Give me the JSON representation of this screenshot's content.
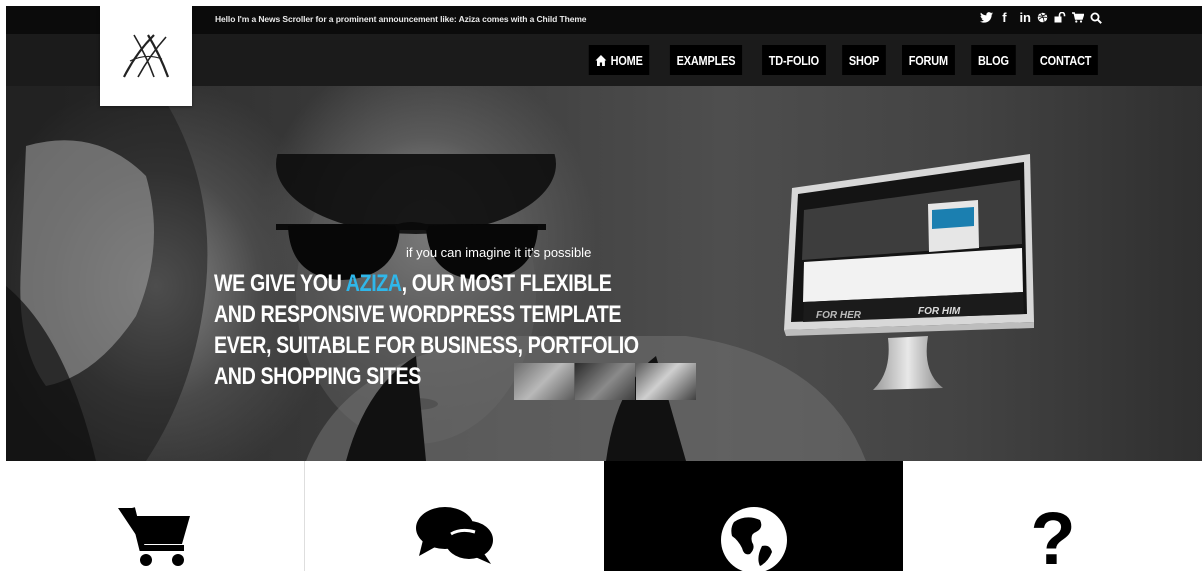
{
  "topbar": {
    "ticker": "Hello I'm a News Scroller for a prominent announcement like: Aziza comes with a Child Theme",
    "social_icons": [
      "twitter-icon",
      "facebook-icon",
      "linkedin-icon",
      "dribbble-icon",
      "lock-icon",
      "cart-icon",
      "search-icon"
    ],
    "facebook_glyph": "f",
    "linkedin_glyph": "in"
  },
  "logo": {
    "name": "aziza-logo"
  },
  "nav": {
    "items": [
      {
        "label": "HOME",
        "icon": "home-icon"
      },
      {
        "label": "EXAMPLES"
      },
      {
        "label": "TD-FOLIO"
      },
      {
        "label": "SHOP"
      },
      {
        "label": "FORUM"
      },
      {
        "label": "BLOG"
      },
      {
        "label": "CONTACT"
      }
    ]
  },
  "hero": {
    "tagline": "if you can imagine it it's possible",
    "headline_pre": "WE GIVE YOU ",
    "headline_accent": "AZIZA",
    "headline_post": ", OUR MOST FLEXIBLE AND RESPONSIVE WORDPRESS TEMPLATE EVER, SUITABLE FOR BUSINESS, PORTFOLIO AND SHOPPING SITES",
    "accent_color": "#2fb7ea",
    "monitor_labels": {
      "left": "FOR HER",
      "right": "FOR HIM"
    }
  },
  "features": [
    {
      "icon": "shopping-cart-icon"
    },
    {
      "icon": "comments-icon"
    },
    {
      "icon": "globe-icon"
    },
    {
      "icon": "question-mark-icon",
      "glyph": "?"
    }
  ]
}
